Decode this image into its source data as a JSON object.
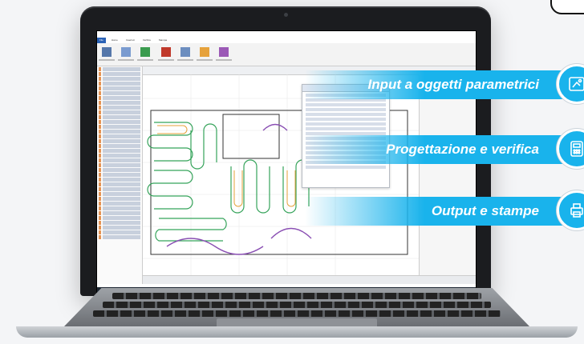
{
  "callouts": [
    {
      "label": "Input a oggetti parametrici",
      "icon": "blueprint-icon"
    },
    {
      "label": "Progettazione e verifica",
      "icon": "calculator-icon"
    },
    {
      "label": "Output e stampe",
      "icon": "printer-icon"
    }
  ],
  "colors": {
    "accent": "#19b3ec",
    "ribbon_active": "#2a62b6",
    "tree_highlight": "#e07b2b",
    "plan_green": "#35a35a",
    "plan_purple": "#8a4fb3"
  },
  "app": {
    "ribbon_tabs": [
      "File",
      "Home",
      "Inserisci",
      "Verifica",
      "Stampa"
    ]
  }
}
